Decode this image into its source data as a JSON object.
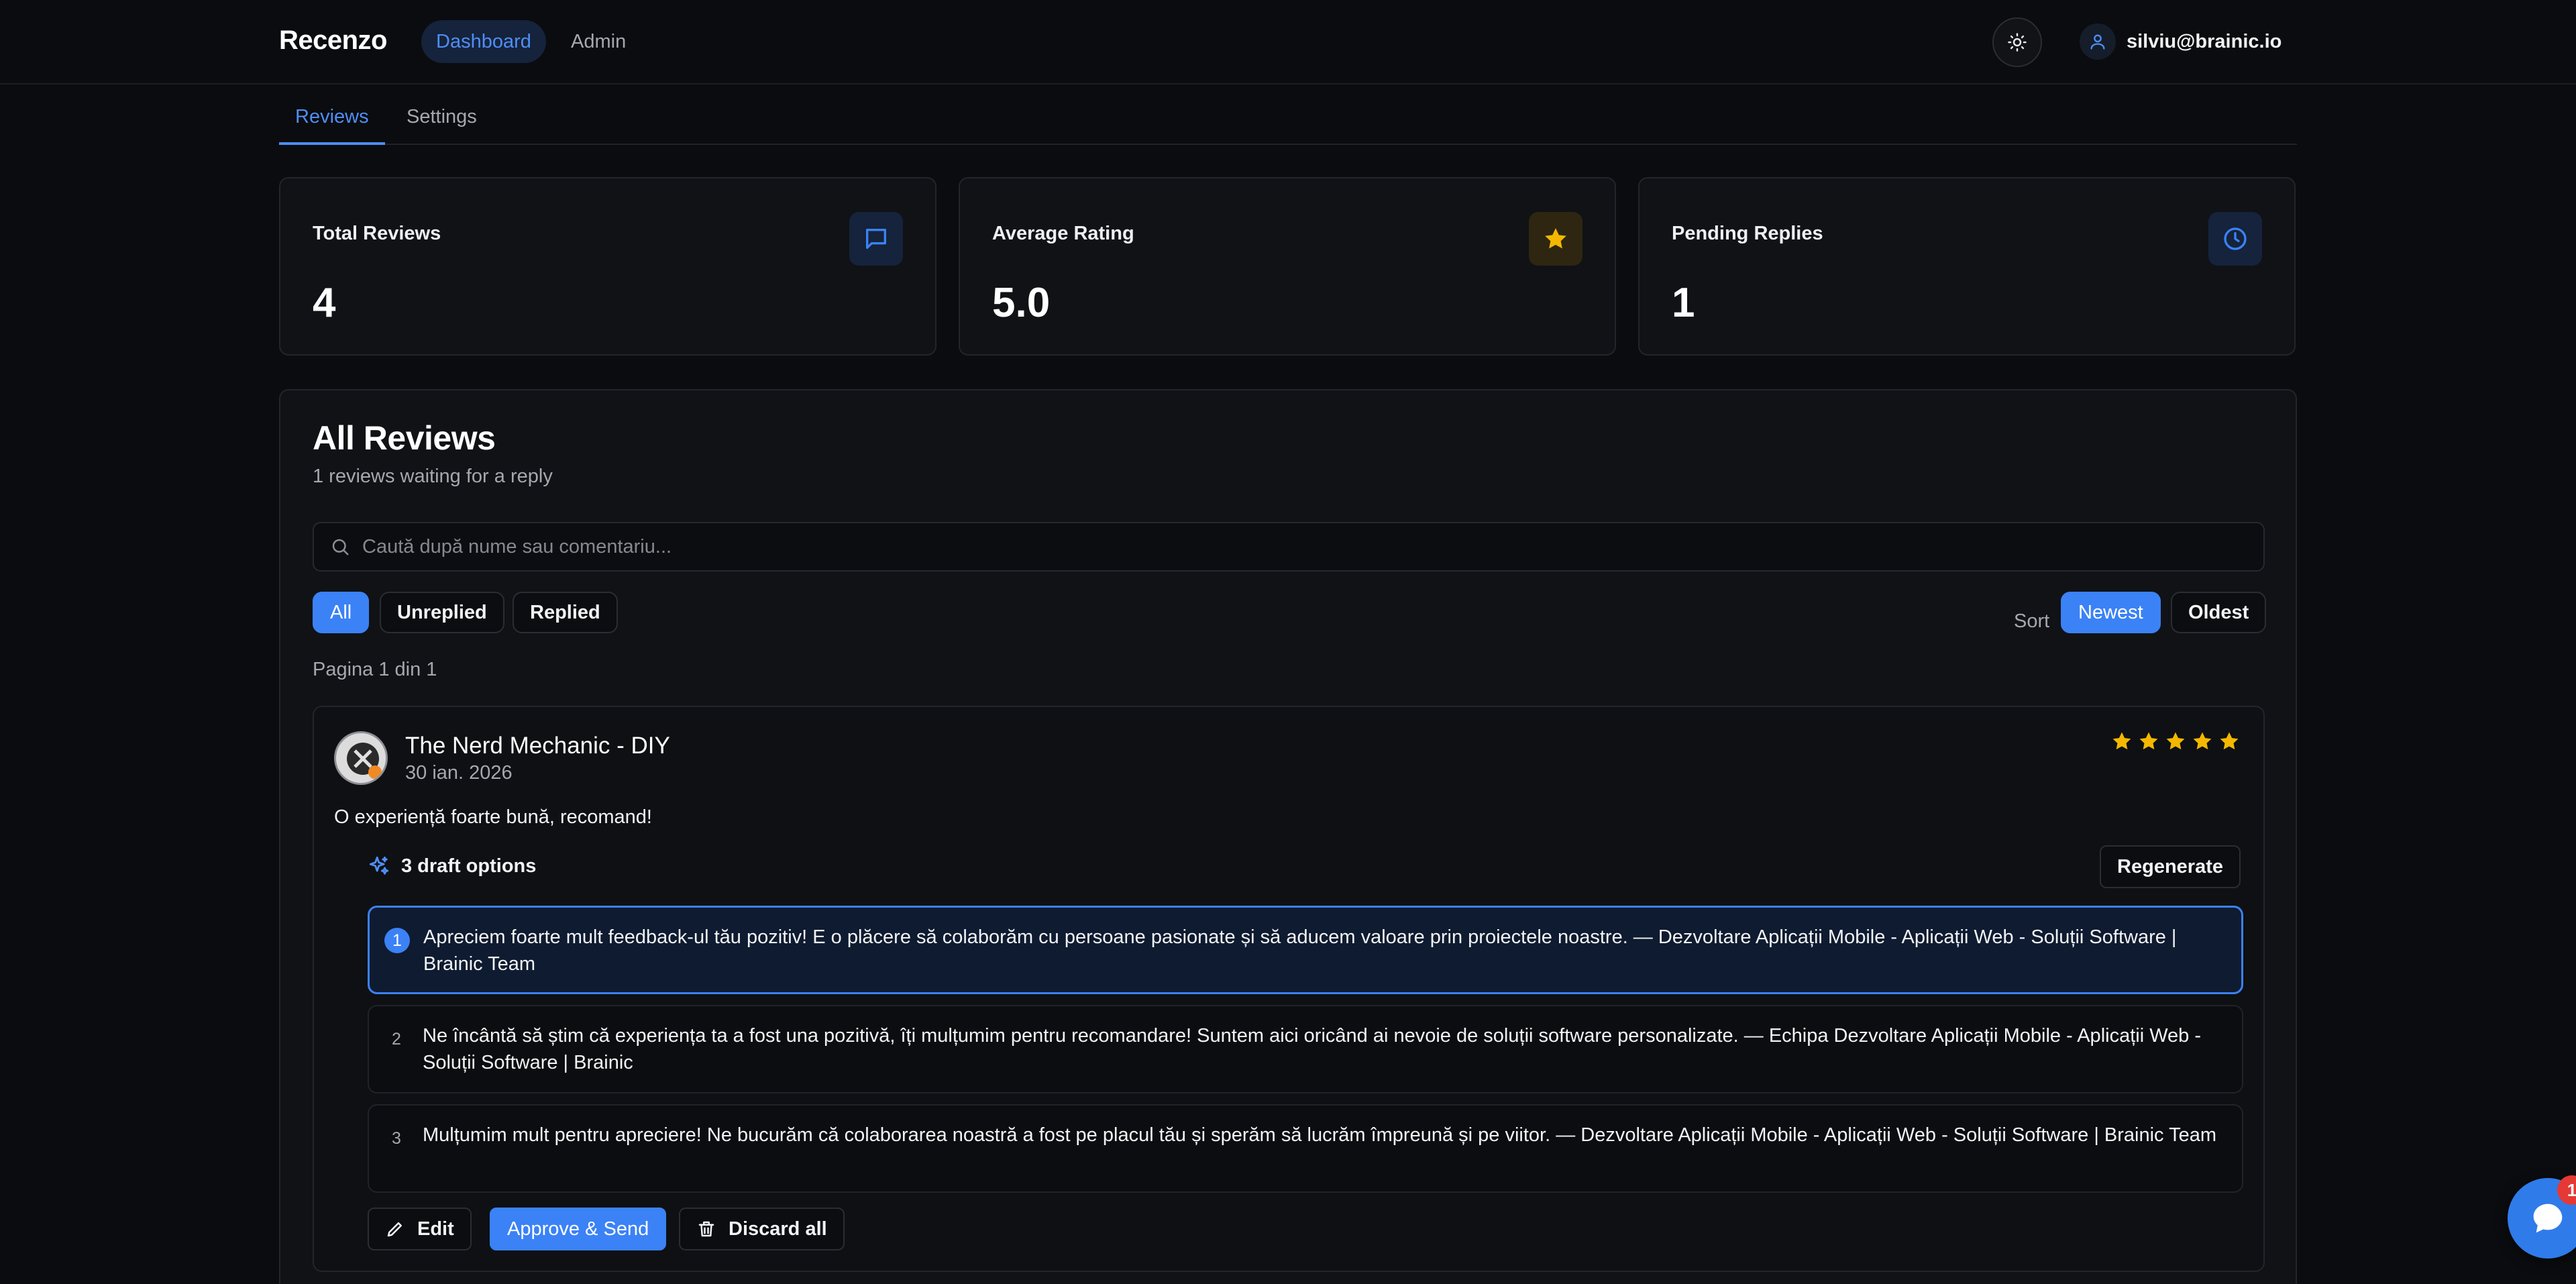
{
  "header": {
    "brand": "Recenzo",
    "nav": [
      {
        "label": "Dashboard",
        "active": true
      },
      {
        "label": "Admin",
        "active": false
      }
    ],
    "theme_toggle_icon": "sun-icon",
    "user_email": "silviu@brainic.io"
  },
  "tabs": [
    {
      "label": "Reviews",
      "active": true
    },
    {
      "label": "Settings",
      "active": false
    }
  ],
  "stats": [
    {
      "label": "Total Reviews",
      "value": "4",
      "icon": "message-square-icon",
      "icon_color": "#3b82f6"
    },
    {
      "label": "Average Rating",
      "value": "5.0",
      "icon": "star-icon",
      "icon_color": "#f5b800"
    },
    {
      "label": "Pending Replies",
      "value": "1",
      "icon": "clock-icon",
      "icon_color": "#3b82f6"
    }
  ],
  "reviews": {
    "title": "All Reviews",
    "subtitle": "1 reviews waiting for a reply",
    "search_placeholder": "Caută după nume sau comentariu...",
    "filters": [
      {
        "label": "All",
        "active": true
      },
      {
        "label": "Unreplied",
        "active": false
      },
      {
        "label": "Replied",
        "active": false
      }
    ],
    "sort_label": "Sort",
    "sort_options": [
      {
        "label": "Newest",
        "active": true
      },
      {
        "label": "Oldest",
        "active": false
      }
    ],
    "pagination": "Pagina 1 din 1",
    "items": [
      {
        "reviewer": "The Nerd Mechanic - DIY",
        "date": "30 ian. 2026",
        "rating": 5,
        "text": "O experiență foarte bună, recomand!",
        "drafts_label": "3 draft options",
        "regenerate_label": "Regenerate",
        "drafts": [
          {
            "num": "1",
            "selected": true,
            "text": "Apreciem foarte mult feedback-ul tău pozitiv! E o plăcere să colaborăm cu persoane pasionate și să aducem valoare prin proiectele noastre. — Dezvoltare Aplicații Mobile - Aplicații Web - Soluții Software | Brainic Team"
          },
          {
            "num": "2",
            "selected": false,
            "text": "Ne încântă să știm că experiența ta a fost una pozitivă, îți mulțumim pentru recomandare! Suntem aici oricând ai nevoie de soluții software personalizate. — Echipa Dezvoltare Aplicații Mobile - Aplicații Web - Soluții Software | Brainic"
          },
          {
            "num": "3",
            "selected": false,
            "text": "Mulțumim mult pentru apreciere! Ne bucurăm că colaborarea noastră a fost pe placul tău și sperăm să lucrăm împreună și pe viitor. — Dezvoltare Aplicații Mobile - Aplicații Web - Soluții Software | Brainic Team"
          }
        ],
        "actions": {
          "edit": "Edit",
          "approve": "Approve & Send",
          "discard": "Discard all"
        }
      }
    ]
  },
  "chat_widget": {
    "icon": "chat-bubble-icon",
    "badge_count": "1"
  },
  "colors": {
    "accent": "#3b82f6",
    "star": "#f5b800",
    "background": "#0b0c0f",
    "badge": "#e53935"
  }
}
